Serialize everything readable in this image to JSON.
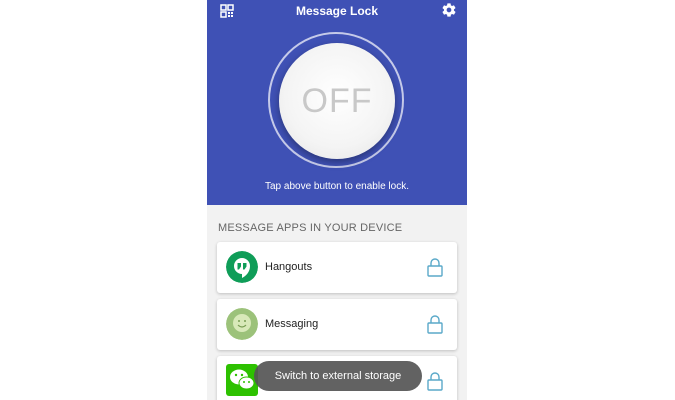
{
  "app_bar": {
    "title": "Message Lock",
    "left_icon": "grid-icon",
    "right_icon": "gear-icon"
  },
  "lock_toggle": {
    "state_label": "OFF",
    "hint": "Tap above button to enable lock."
  },
  "section": {
    "title": "MESSAGE APPS IN YOUR DEVICE"
  },
  "apps": [
    {
      "name": "Hangouts",
      "icon": "hangouts-icon",
      "lock_icon": "lock-icon"
    },
    {
      "name": "Messaging",
      "icon": "messaging-icon",
      "lock_icon": "lock-icon"
    },
    {
      "name": "",
      "icon": "wechat-icon",
      "lock_icon": "lock-icon"
    }
  ],
  "toast": {
    "message": "Switch to external storage"
  },
  "colors": {
    "primary": "#3f51b5",
    "hangouts": "#0f9d58",
    "messaging": "#9cc27a",
    "wechat": "#2dc100",
    "lock": "#5aa9c9"
  }
}
